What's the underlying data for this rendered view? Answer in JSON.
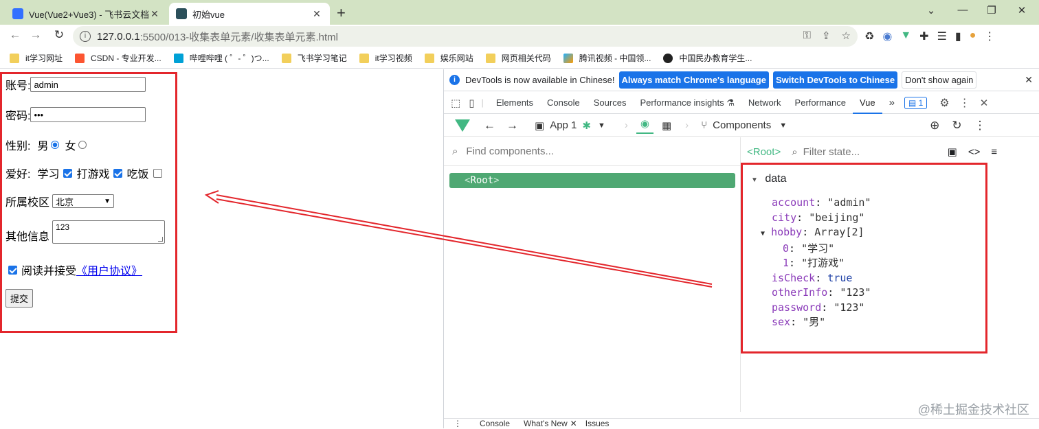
{
  "tabs": [
    {
      "title": "Vue(Vue2+Vue3) - 飞书云文档",
      "icon": "doc-icon",
      "active": false
    },
    {
      "title": "初始vue",
      "icon": "vscode-icon",
      "active": true
    }
  ],
  "url": {
    "host": "127.0.0.1",
    "path": ":5500/013-收集表单元素/收集表单元素.html"
  },
  "bookmarks": [
    {
      "label": "it学习网址",
      "icon": "folder-icon"
    },
    {
      "label": "CSDN - 专业开发...",
      "icon": "csdn-icon"
    },
    {
      "label": "哔哩哔哩 ( ゜- ゜)つ...",
      "icon": "bilibili-icon"
    },
    {
      "label": "飞书学习笔记",
      "icon": "folder-icon"
    },
    {
      "label": "it学习视频",
      "icon": "folder-icon"
    },
    {
      "label": "娱乐网站",
      "icon": "folder-icon"
    },
    {
      "label": "网页相关代码",
      "icon": "folder-icon"
    },
    {
      "label": "腾讯视频 - 中国领...",
      "icon": "tencent-video-icon"
    },
    {
      "label": "中国民办教育学生...",
      "icon": "globe-icon"
    }
  ],
  "form": {
    "account_label": "账号:",
    "account_value": "admin",
    "password_label": "密码:",
    "password_value": "•••",
    "sex_label": "性别:",
    "sex_male": "男",
    "sex_female": "女",
    "hobby_label": "爱好:",
    "hobby_study": "学习",
    "hobby_game": "打游戏",
    "hobby_eat": "吃饭",
    "campus_label": "所属校区",
    "campus_value": "北京",
    "other_label": "其他信息",
    "other_value": "123",
    "agree_text": "阅读并接受",
    "agree_link": "《用户协议》",
    "submit": "提交"
  },
  "devtools": {
    "info_text": "DevTools is now available in Chinese!",
    "btn_match": "Always match Chrome's language",
    "btn_switch": "Switch DevTools to Chinese",
    "btn_dont": "Don't show again",
    "tabs": [
      "Elements",
      "Console",
      "Sources",
      "Performance insights",
      "Network",
      "Performance",
      "Vue"
    ],
    "issues_count": "1",
    "app_label": "App 1",
    "components_label": "Components",
    "find_placeholder": "Find components...",
    "root_tag": "Root",
    "state_root": "<Root>",
    "filter_placeholder": "Filter state...",
    "section": "data",
    "state": [
      {
        "key": "account",
        "value": "\"admin\""
      },
      {
        "key": "city",
        "value": "\"beijing\""
      },
      {
        "key": "hobby",
        "value": "Array[2]"
      },
      {
        "key": "0",
        "value": "\"学习\""
      },
      {
        "key": "1",
        "value": "\"打游戏\""
      },
      {
        "key": "isCheck",
        "value": "true"
      },
      {
        "key": "otherInfo",
        "value": "\"123\""
      },
      {
        "key": "password",
        "value": "\"123\""
      },
      {
        "key": "sex",
        "value": "\"男\""
      }
    ],
    "footer_tabs": [
      "Console",
      "What's New",
      "Issues"
    ]
  },
  "watermark": "@稀土掘金技术社区",
  "colors": {
    "accent": "#1a73e8",
    "vue_green": "#42b883",
    "annotation_red": "#e3262c"
  }
}
